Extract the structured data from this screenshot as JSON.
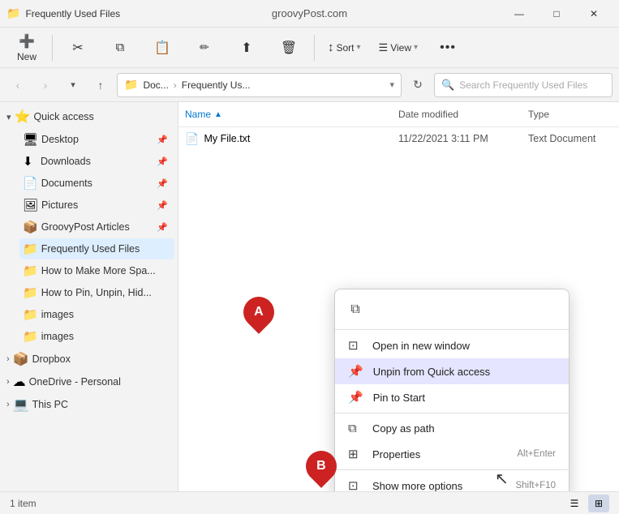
{
  "window": {
    "title": "Frequently Used Files",
    "site": "groovyPost.com"
  },
  "titlebar": {
    "minimize": "—",
    "maximize": "□",
    "close": "✕"
  },
  "toolbar": {
    "new_label": "New",
    "cut_icon": "✂",
    "copy_icon": "⧉",
    "paste_icon": "📋",
    "rename_icon": "✏",
    "share_icon": "⬆",
    "delete_icon": "🗑",
    "sort_label": "Sort",
    "view_label": "View",
    "more_icon": "•••"
  },
  "addressbar": {
    "path_display": "Doc... › Frequently Us...",
    "folder_icon": "📁",
    "search_placeholder": "Search Frequently Used Files"
  },
  "sidebar": {
    "sections": [
      {
        "id": "quick-access",
        "label": "Quick access",
        "icon": "⭐",
        "expanded": true,
        "items": [
          {
            "id": "desktop",
            "label": "Desktop",
            "icon": "🖥",
            "pinned": true
          },
          {
            "id": "downloads",
            "label": "Downloads",
            "icon": "⬇",
            "pinned": true
          },
          {
            "id": "documents",
            "label": "Documents",
            "icon": "📄",
            "pinned": true
          },
          {
            "id": "pictures",
            "label": "Pictures",
            "icon": "🖼",
            "pinned": true
          },
          {
            "id": "groovypost",
            "label": "GroovyPost Articles",
            "icon": "📦",
            "pinned": true
          },
          {
            "id": "frequently-used",
            "label": "Frequently Used Files",
            "icon": "📁",
            "selected": true
          },
          {
            "id": "make-more",
            "label": "How to Make More Spa...",
            "icon": "📁"
          },
          {
            "id": "pin-unpin",
            "label": "How to Pin, Unpin, Hid...",
            "icon": "📁"
          },
          {
            "id": "images1",
            "label": "images",
            "icon": "📁"
          },
          {
            "id": "images2",
            "label": "images",
            "icon": "📁"
          }
        ]
      },
      {
        "id": "dropbox",
        "label": "Dropbox",
        "icon": "📦",
        "expanded": false
      },
      {
        "id": "onedrive",
        "label": "OneDrive - Personal",
        "icon": "☁",
        "expanded": false
      },
      {
        "id": "thispc",
        "label": "This PC",
        "icon": "💻",
        "expanded": false
      }
    ]
  },
  "filelist": {
    "columns": {
      "name": "Name",
      "date_modified": "Date modified",
      "type": "Type"
    },
    "files": [
      {
        "name": "My File.txt",
        "icon": "📄",
        "date_modified": "11/22/2021 3:11 PM",
        "type": "Text Document"
      }
    ]
  },
  "context_menu": {
    "top_icon": "⧉",
    "items": [
      {
        "id": "open-new-window",
        "icon": "⊡",
        "label": "Open in new window",
        "shortcut": ""
      },
      {
        "id": "unpin-quick-access",
        "icon": "📌",
        "label": "Unpin from Quick access",
        "shortcut": "",
        "highlighted": true
      },
      {
        "id": "pin-to-start",
        "icon": "📌",
        "label": "Pin to Start",
        "shortcut": ""
      },
      {
        "id": "copy-as-path",
        "icon": "⧉",
        "label": "Copy as path",
        "shortcut": ""
      },
      {
        "id": "properties",
        "icon": "⊞",
        "label": "Properties",
        "shortcut": "Alt+Enter"
      },
      {
        "id": "show-more",
        "icon": "⊡",
        "label": "Show more options",
        "shortcut": "Shift+F10"
      }
    ]
  },
  "statusbar": {
    "items_count": "1 item"
  },
  "annotations": {
    "a": "A",
    "b": "B"
  }
}
